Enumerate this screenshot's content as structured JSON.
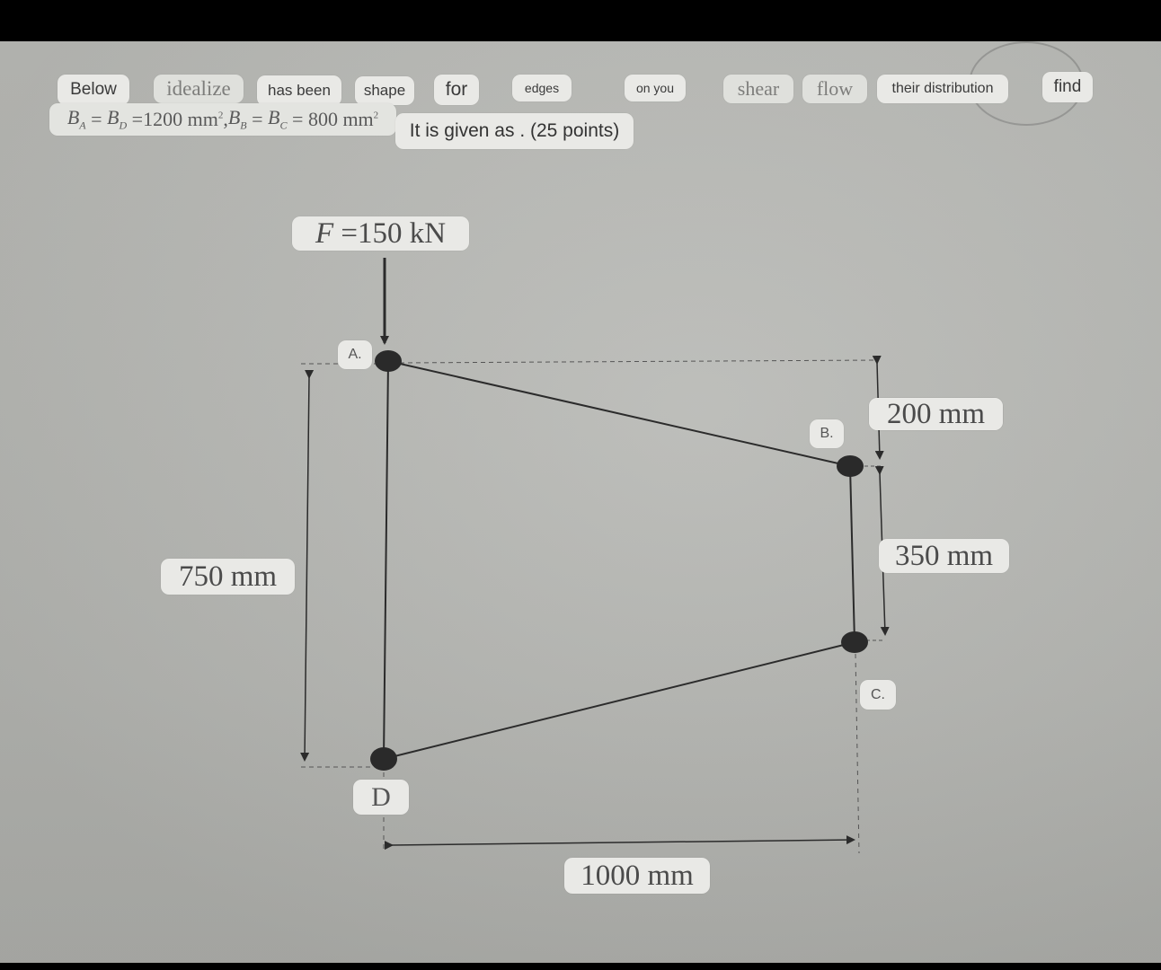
{
  "question": {
    "word_chips": [
      "Below",
      "idealize",
      "has been",
      "shape",
      "for",
      "edges",
      "on you",
      "shear",
      "flow",
      "their distribution",
      "find"
    ],
    "given_formula": {
      "B_A": "B",
      "sub_A": "A",
      "B_D": "B",
      "sub_D": "D",
      "value_AD": "1200 mm",
      "B_B": "B",
      "sub_B": "B",
      "B_C": "B",
      "sub_C": "C",
      "value_BC": "800 mm",
      "exp": "2",
      "eq": "=",
      "comma": ","
    },
    "given_text": "It is given as . (25 points)"
  },
  "diagram": {
    "force_label": "F =150 kN",
    "force_F": "F",
    "force_rest": " =150 kN",
    "nodes": [
      {
        "id": "A",
        "label": "A.",
        "area_mm2": 1200
      },
      {
        "id": "B",
        "label": "B.",
        "area_mm2": 800
      },
      {
        "id": "C",
        "label": "C.",
        "area_mm2": 800
      },
      {
        "id": "D",
        "label": "D",
        "area_mm2": 1200
      }
    ],
    "dimensions": {
      "height_AD": "750 mm",
      "offset_AB": "200 mm",
      "height_BC": "350 mm",
      "width": "1000 mm"
    },
    "colors": {
      "ink": "#2b2b2b",
      "node": "#2a2a2a",
      "chip_bg": "#e9e9e6",
      "background": "#b7b8b4"
    }
  }
}
